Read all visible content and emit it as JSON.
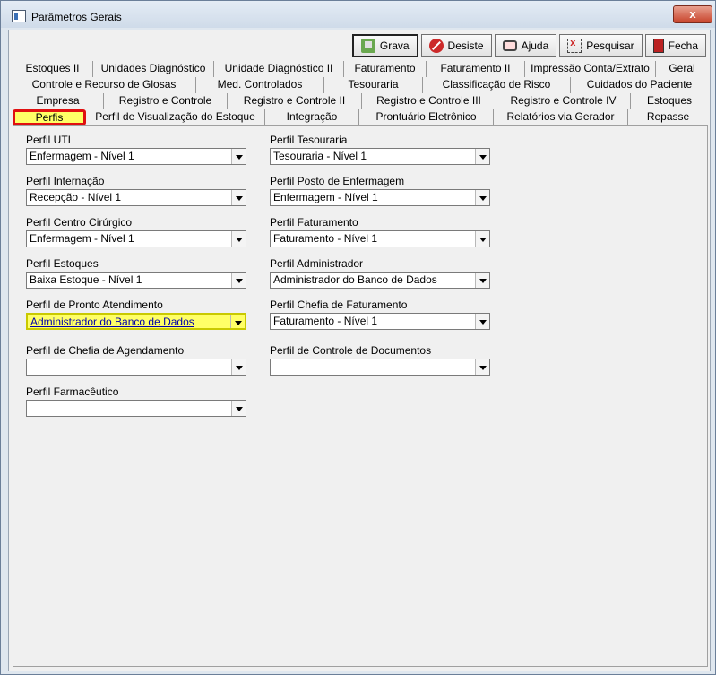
{
  "window": {
    "title": "Parâmetros Gerais",
    "close_label": "x"
  },
  "toolbar": {
    "grava": "Grava",
    "desiste": "Desiste",
    "ajuda": "Ajuda",
    "pesquisar": "Pesquisar",
    "fecha": "Fecha"
  },
  "tabs": {
    "row1": [
      "Estoques II",
      "Unidades Diagnóstico",
      "Unidade Diagnóstico II",
      "Faturamento",
      "Faturamento II",
      "Impressão Conta/Extrato",
      "Geral"
    ],
    "row2": [
      "Controle e Recurso de Glosas",
      "Med. Controlados",
      "Tesouraria",
      "Classificação de Risco",
      "Cuidados do Paciente"
    ],
    "row3": [
      "Empresa",
      "Registro e Controle",
      "Registro e Controle II",
      "Registro e Controle III",
      "Registro e Controle IV",
      "Estoques"
    ],
    "row4": [
      "Perfis",
      "Perfil de Visualização do Estoque",
      "Integração",
      "Prontuário Eletrônico",
      "Relatórios via Gerador",
      "Repasse"
    ],
    "selected": "Perfis"
  },
  "fields": {
    "perfil_uti": {
      "label": "Perfil UTI",
      "value": "Enfermagem - Nível 1"
    },
    "perfil_internacao": {
      "label": "Perfil Internação",
      "value": "Recepção - Nível 1"
    },
    "perfil_centro_cirurgico": {
      "label": "Perfil Centro Cirúrgico",
      "value": "Enfermagem - Nível 1"
    },
    "perfil_estoques": {
      "label": "Perfil Estoques",
      "value": "Baixa Estoque - Nível 1"
    },
    "perfil_pronto_atendimento": {
      "label": "Perfil de Pronto Atendimento",
      "value": "Administrador do Banco de Dados"
    },
    "perfil_chefia_agendamento": {
      "label": "Perfil de Chefia de Agendamento",
      "value": ""
    },
    "perfil_farmaceutico": {
      "label": "Perfil Farmacêutico",
      "value": ""
    },
    "perfil_tesouraria": {
      "label": "Perfil Tesouraria",
      "value": "Tesouraria - Nível 1"
    },
    "perfil_posto_enfermagem": {
      "label": "Perfil Posto de Enfermagem",
      "value": "Enfermagem - Nível 1"
    },
    "perfil_faturamento": {
      "label": "Perfil Faturamento",
      "value": "Faturamento - Nível 1"
    },
    "perfil_administrador": {
      "label": "Perfil Administrador",
      "value": "Administrador do Banco de Dados"
    },
    "perfil_chefia_faturamento": {
      "label": "Perfil Chefia de Faturamento",
      "value": "Faturamento - Nível 1"
    },
    "perfil_controle_documentos": {
      "label": "Perfil de Controle de Documentos",
      "value": ""
    }
  },
  "colors": {
    "highlight": "#ffff66",
    "tab_outline": "#e01010"
  }
}
